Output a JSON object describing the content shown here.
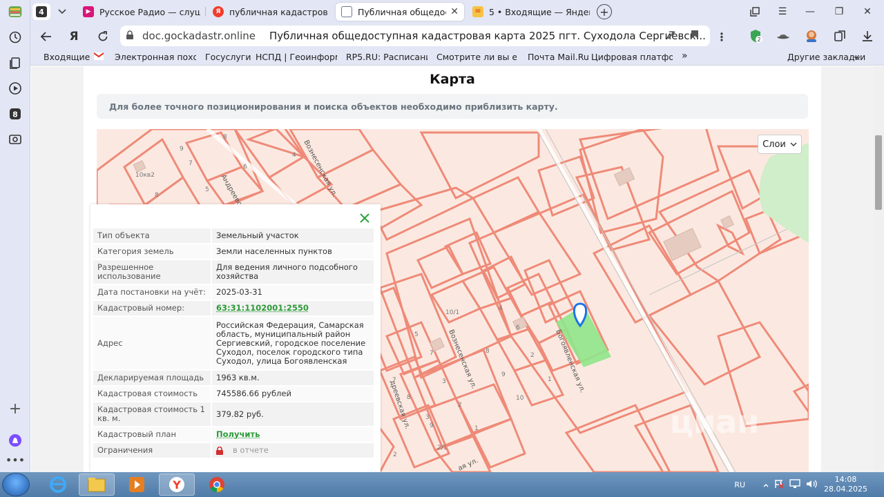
{
  "tabs": {
    "count": "4",
    "items": [
      {
        "label": "Русское Радио — слушать",
        "color": "#d9157a"
      },
      {
        "label": "публичная кадастровая к",
        "color": "#f23c2c"
      },
      {
        "label": "Публичная общедосту",
        "color": "#6b7a8c"
      },
      {
        "label": "5 • Входящие — Яндекс П",
        "color": "#e3321f"
      }
    ]
  },
  "address": {
    "domain": "doc.gockadastr.online",
    "title": "Публичная общедоступная кадастровая карта 2025 пгт. Суходола Сергиевск..."
  },
  "extensions": {
    "badge": "2"
  },
  "bookmarks": [
    "Входящие",
    "Электронная похоз",
    "Госуслуги",
    "НСПД | Геоинформа",
    "RP5.RU: Расписание",
    "Смотрите ли вы еже",
    "Почта Mail.Ru",
    "Цифровая платформ",
    "»",
    "Другие закладки"
  ],
  "page": {
    "title": "Карта",
    "hint": "Для более точного позиционирования и поиска объектов необходимо приблизить карту.",
    "layers_btn": "Слои"
  },
  "map_labels": {
    "streets": [
      "Вознесенская ул.",
      "Андреевск",
      "Вознесенская ул.",
      "Богоявленская ул.",
      "дреевская ул.",
      "ая ул."
    ],
    "numbers": [
      "9",
      "7",
      "8",
      "6",
      "4",
      "5",
      "10кв2",
      "8",
      "10/1",
      "4",
      "6",
      "5",
      "7",
      "8",
      "2",
      "3",
      "9",
      "1",
      "10",
      "7",
      "8",
      "3",
      "2",
      "9",
      "1",
      "2/1",
      "2"
    ],
    "watermark": "циан"
  },
  "popup": {
    "rows": [
      {
        "k": "Тип объекта",
        "v": "Земельный участок"
      },
      {
        "k": "Категория земель",
        "v": "Земли населенных пунктов"
      },
      {
        "k": "Разрешенное использование",
        "v": "Для ведения личного подсобного хозяйства"
      },
      {
        "k": "Дата постановки на учёт:",
        "v": "2025-03-31"
      },
      {
        "k": "Кадастровый номер:",
        "v": "63:31:1102001:2550"
      },
      {
        "k": "Адрес",
        "v": "Российская Федерация, Самарская область, муниципальный район Сергиевский, городское поселение Суходол, поселок городского типа Суходол, улица Богоявленская"
      },
      {
        "k": "Декларируемая площадь",
        "v": "1963 кв.м."
      },
      {
        "k": "Кадастровая стоимость",
        "v": "745586.66 рублей"
      },
      {
        "k": "Кадастровая стоимость 1 кв. м.",
        "v": "379.82 руб."
      },
      {
        "k": "Кадастровый план",
        "v": "Получить"
      },
      {
        "k": "Ограничения",
        "v": "в отчете"
      }
    ]
  },
  "taskbar": {
    "lang": "RU",
    "time": "14:08",
    "date": "28.04.2025"
  },
  "colors": {
    "browser_chrome": "#e3e6f4",
    "parcel_stroke": "#ef8a78",
    "map_bg": "#fbe9e1",
    "selected_parcel": "#8fe58a",
    "link_green": "#2a9a36"
  }
}
